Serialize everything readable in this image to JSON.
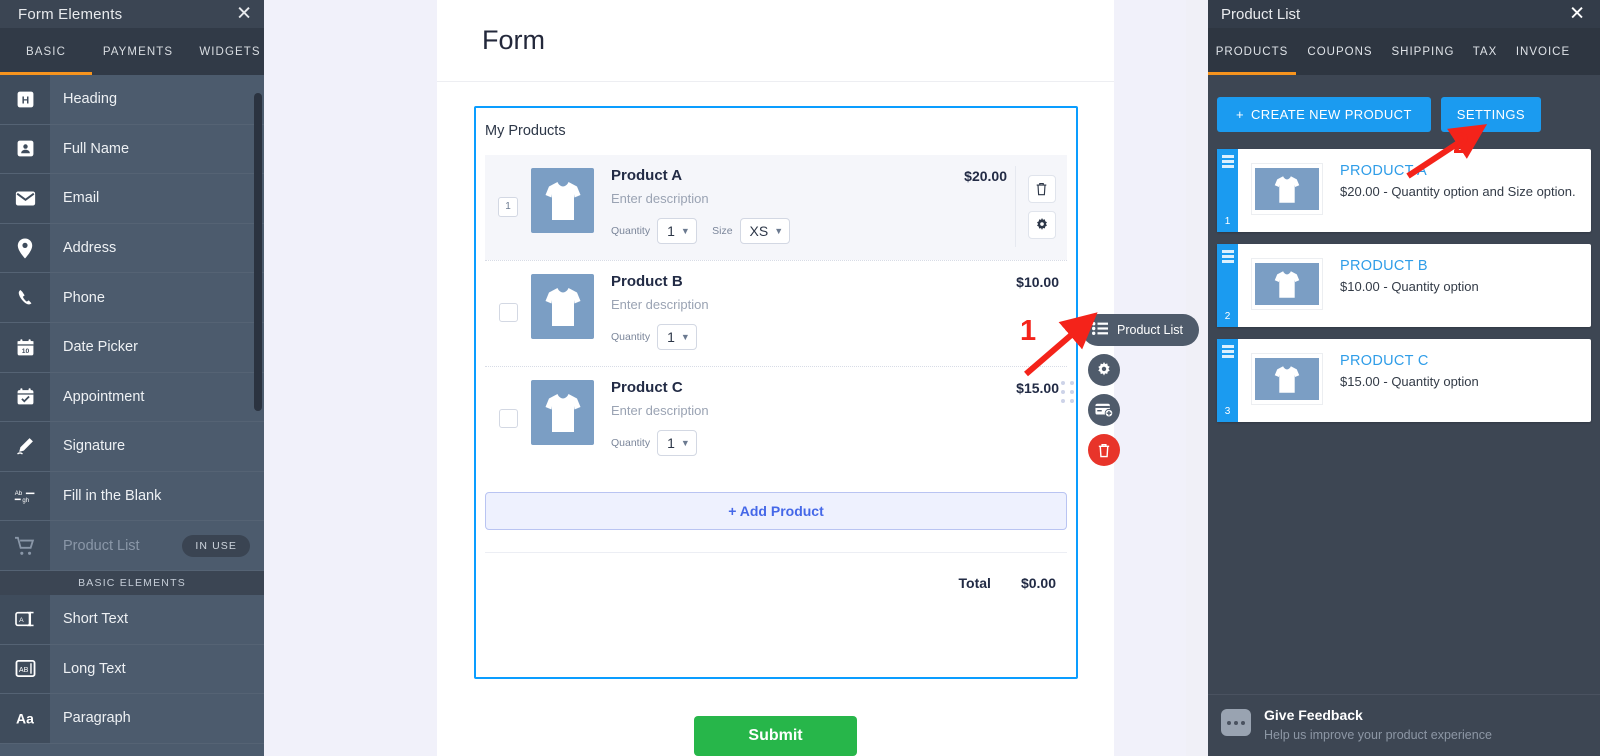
{
  "sidebar": {
    "title": "Form Elements",
    "close_icon": "close-icon",
    "tabs": [
      {
        "label": "BASIC",
        "active": true
      },
      {
        "label": "PAYMENTS",
        "active": false
      },
      {
        "label": "WIDGETS",
        "active": false
      }
    ],
    "items": [
      {
        "label": "Heading",
        "icon": "heading-icon"
      },
      {
        "label": "Full Name",
        "icon": "person-icon"
      },
      {
        "label": "Email",
        "icon": "envelope-icon"
      },
      {
        "label": "Address",
        "icon": "map-pin-icon"
      },
      {
        "label": "Phone",
        "icon": "phone-icon"
      },
      {
        "label": "Date Picker",
        "icon": "calendar-icon"
      },
      {
        "label": "Appointment",
        "icon": "calendar-check-icon"
      },
      {
        "label": "Signature",
        "icon": "pen-icon"
      },
      {
        "label": "Fill in the Blank",
        "icon": "fill-blank-icon"
      },
      {
        "label": "Product List",
        "icon": "shopping-cart-icon",
        "badge": "IN USE",
        "disabled": true
      }
    ],
    "group_label": "BASIC ELEMENTS",
    "items2": [
      {
        "label": "Short Text",
        "icon": "short-text-icon"
      },
      {
        "label": "Long Text",
        "icon": "long-text-icon"
      },
      {
        "label": "Paragraph",
        "icon": "paragraph-icon"
      }
    ]
  },
  "form": {
    "title": "Form",
    "widget": {
      "heading": "My Products",
      "add_product_label": "+ Add Product",
      "total_label": "Total",
      "total_value": "$0.00",
      "products": [
        {
          "selector": "1",
          "selector_type": "quantity",
          "name": "Product A",
          "description": "Enter description",
          "price": "$20.00",
          "options": [
            {
              "label": "Quantity",
              "value": "1"
            },
            {
              "label": "Size",
              "value": "XS"
            }
          ],
          "actions": [
            "trash-icon",
            "gear-icon"
          ],
          "selected": true
        },
        {
          "selector": "",
          "selector_type": "checkbox",
          "name": "Product B",
          "description": "Enter description",
          "price": "$10.00",
          "options": [
            {
              "label": "Quantity",
              "value": "1"
            }
          ],
          "actions": [],
          "selected": false
        },
        {
          "selector": "",
          "selector_type": "checkbox",
          "name": "Product C",
          "description": "Enter description",
          "price": "$15.00",
          "options": [
            {
              "label": "Quantity",
              "value": "1"
            }
          ],
          "actions": [],
          "selected": false
        }
      ]
    },
    "submit_label": "Submit"
  },
  "widget_toolbar": {
    "label": "Product List",
    "list_icon": "list-icon",
    "gear_icon": "gear-icon",
    "payment_icon": "add-payment-icon",
    "trash_icon": "trash-icon"
  },
  "right_panel": {
    "title": "Product List",
    "close_icon": "close-icon",
    "tabs": [
      {
        "label": "PRODUCTS",
        "active": true
      },
      {
        "label": "COUPONS",
        "active": false
      },
      {
        "label": "SHIPPING",
        "active": false
      },
      {
        "label": "TAX",
        "active": false
      },
      {
        "label": "INVOICE",
        "active": false
      }
    ],
    "create_label": "CREATE NEW PRODUCT",
    "settings_label": "SETTINGS",
    "products": [
      {
        "num": "1",
        "name": "PRODUCT A",
        "desc": "$20.00 - Quantity option and Size option."
      },
      {
        "num": "2",
        "name": "PRODUCT B",
        "desc": "$10.00 - Quantity option"
      },
      {
        "num": "3",
        "name": "PRODUCT C",
        "desc": "$15.00 - Quantity option"
      }
    ],
    "feedback": {
      "title": "Give Feedback",
      "subtitle": "Help us improve your product experience"
    }
  },
  "annotations": [
    {
      "number": "1",
      "target": "widget-toolbar"
    },
    {
      "number": "2",
      "target": "settings-button"
    }
  ],
  "colors": {
    "accent_orange": "#f7941e",
    "primary_blue": "#1b9bf0",
    "widget_border": "#0a9dff",
    "submit_green": "#27b64a",
    "annotation_red": "#f4231a",
    "sidebar_bg": "#4c5b6d",
    "panel_bg": "#3d4653"
  }
}
